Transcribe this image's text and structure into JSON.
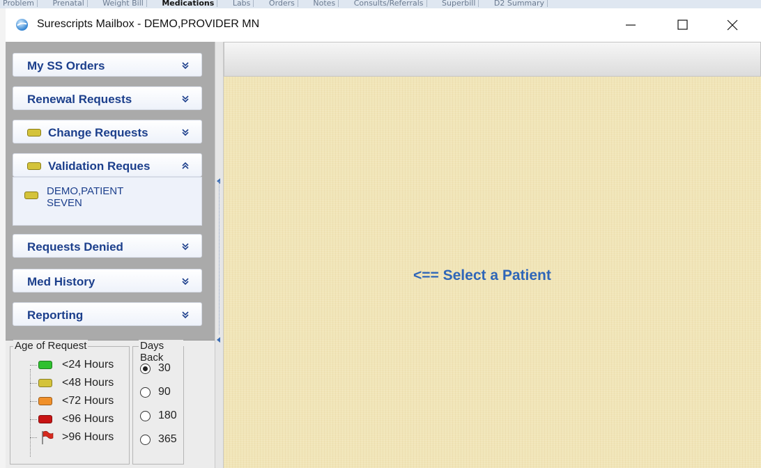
{
  "background_app": {
    "tabs": [
      "Problem",
      "Prenatal",
      "Weight Bill",
      "Medications",
      "Labs",
      "Orders",
      "Notes",
      "Consults/Referrals",
      "Superbill",
      "D2 Summary"
    ],
    "active_tab": "Medications"
  },
  "window": {
    "title": "Surescripts Mailbox - DEMO,PROVIDER MN",
    "minimize": "minimize",
    "maximize": "maximize",
    "close": "close"
  },
  "sidebar": {
    "items": [
      {
        "label": "My SS Orders",
        "icon": null,
        "chevron": "double-chevron-down"
      },
      {
        "label": "Renewal Requests",
        "icon": null,
        "chevron": "double-chevron-down"
      },
      {
        "label": "Change Requests",
        "icon": "yellow-status",
        "chevron": "double-chevron-down"
      },
      {
        "label": "Validation Reques",
        "icon": "yellow-status",
        "chevron": "double-chevron-up"
      },
      {
        "label": "Requests Denied",
        "icon": null,
        "chevron": "double-chevron-down"
      },
      {
        "label": "Med History",
        "icon": null,
        "chevron": "double-chevron-down"
      },
      {
        "label": "Reporting",
        "icon": null,
        "chevron": "double-chevron-down"
      }
    ],
    "expanded": {
      "patient_line1": "DEMO,PATIENT",
      "patient_line2": "SEVEN",
      "patient_icon": "yellow-status"
    }
  },
  "legend": {
    "age_title": "Age of Request",
    "age_rows": [
      {
        "label": "<24 Hours",
        "color": "#2fc12f"
      },
      {
        "label": "<48 Hours",
        "color": "#d4c33a"
      },
      {
        "label": "<72 Hours",
        "color": "#f0902a"
      },
      {
        "label": "<96 Hours",
        "color": "#c81414"
      },
      {
        "label": ">96 Hours",
        "icon": "red-flag-icon"
      }
    ],
    "days_title": "Days Back",
    "days_options": [
      "30",
      "90",
      "180",
      "365"
    ],
    "days_selected": "30"
  },
  "main": {
    "message": "<== Select a Patient"
  },
  "colors": {
    "nav_text": "#1c3f8c",
    "message": "#2f66b8",
    "content_bg": "#f1e5b8"
  }
}
